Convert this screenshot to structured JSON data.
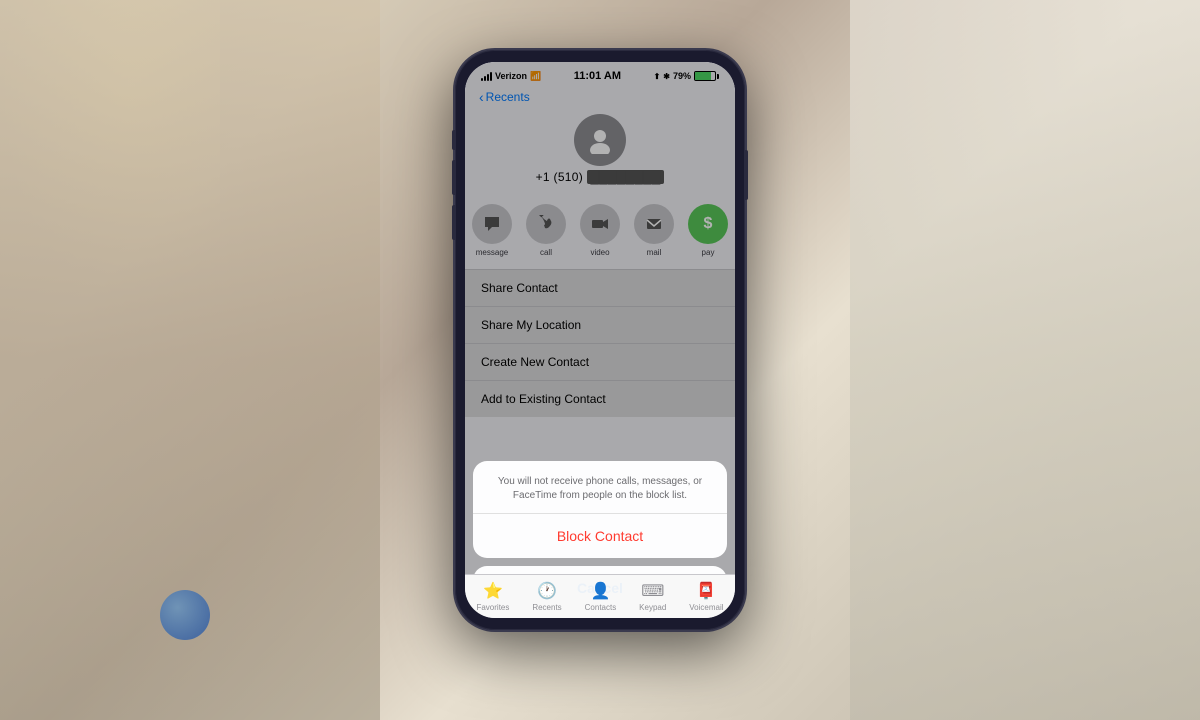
{
  "background": {
    "colors": [
      "#c8bfaa",
      "#d4c9b5",
      "#b8a898",
      "#e8e0d0"
    ]
  },
  "status_bar": {
    "carrier": "Verizon",
    "wifi_icon": "📶",
    "time": "11:01 AM",
    "location_icon": "⬆",
    "bluetooth_icon": "✱",
    "battery_percent": "79%",
    "battery_level": 79
  },
  "nav": {
    "back_label": "Recents"
  },
  "contact": {
    "phone_number_prefix": "+1 (510)",
    "phone_number_redacted": "███████████",
    "avatar_icon": "👤"
  },
  "action_buttons": [
    {
      "id": "message",
      "label": "message",
      "icon": "💬"
    },
    {
      "id": "call",
      "label": "call",
      "icon": "📞"
    },
    {
      "id": "video",
      "label": "video",
      "icon": "📷"
    },
    {
      "id": "mail",
      "label": "mail",
      "icon": "✉"
    },
    {
      "id": "pay",
      "label": "pay",
      "icon": "$"
    }
  ],
  "menu_items": [
    {
      "id": "share-contact",
      "label": "Share Contact"
    },
    {
      "id": "share-location",
      "label": "Share My Location"
    },
    {
      "id": "create-new-contact",
      "label": "Create New Contact"
    },
    {
      "id": "add-existing-contact",
      "label": "Add to Existing Contact"
    }
  ],
  "action_sheet": {
    "message": "You will not receive phone calls, messages, or FaceTime from people on the block list.",
    "block_button": "Block Contact",
    "cancel_button": "Cancel"
  },
  "tab_bar": {
    "items": [
      {
        "id": "favorites",
        "label": "Favorites",
        "icon": "⭐"
      },
      {
        "id": "recents",
        "label": "Recents",
        "icon": "🕐"
      },
      {
        "id": "contacts",
        "label": "Contacts",
        "icon": "👤"
      },
      {
        "id": "keypad",
        "label": "Keypad",
        "icon": "⌨"
      },
      {
        "id": "voicemail",
        "label": "Voicemail",
        "icon": "📮"
      }
    ]
  }
}
